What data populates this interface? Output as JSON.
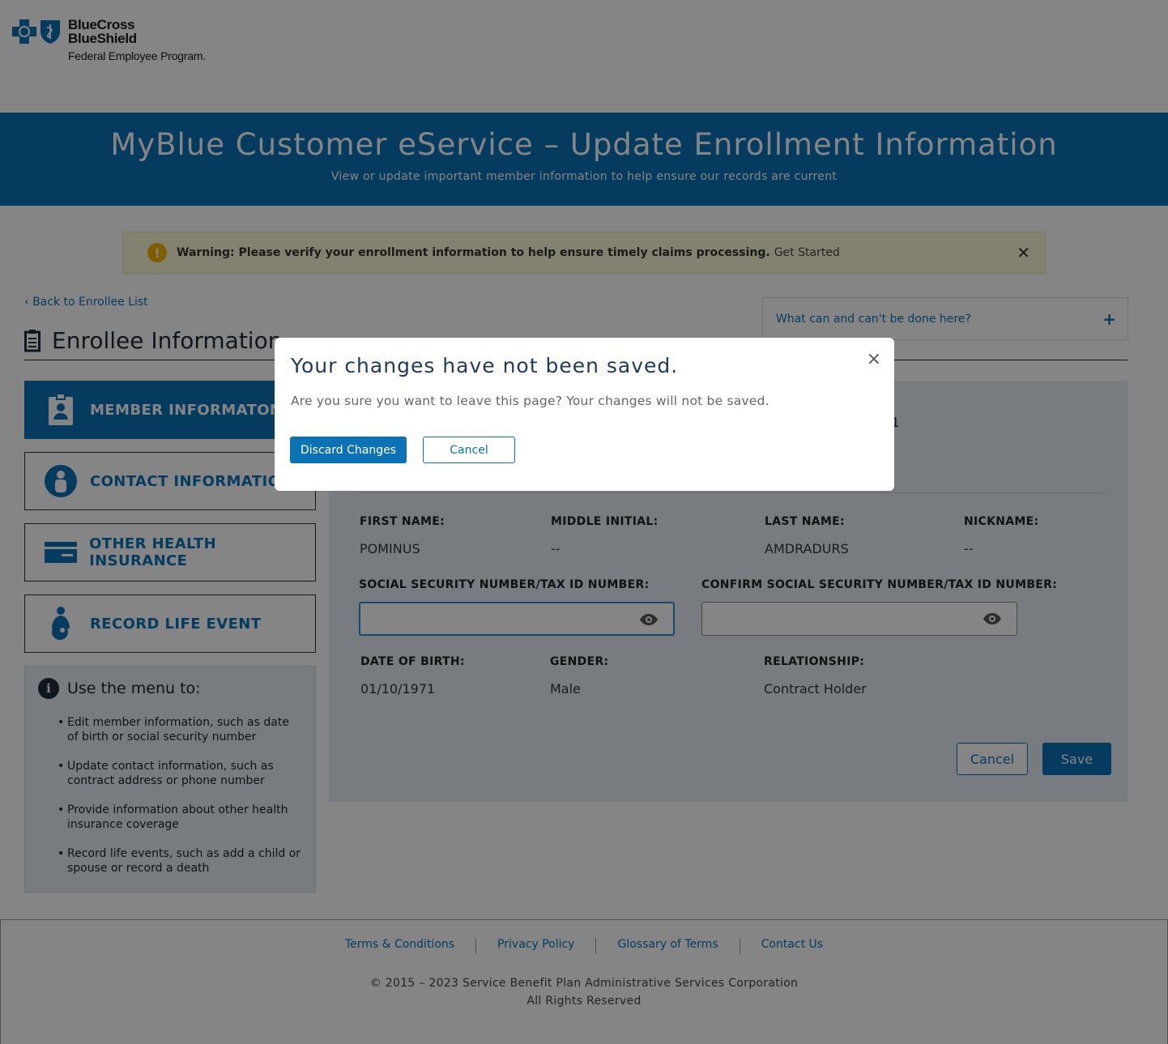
{
  "brand": {
    "line1": "BlueCross",
    "line2": "BlueShield",
    "line3": "Federal Employee Program."
  },
  "hero": {
    "title": "MyBlue Customer eService – Update Enrollment Information",
    "subtitle": "View or update important member information to help ensure our records are current"
  },
  "warning": {
    "text": "Warning: Please verify your enrollment information to help ensure timely claims processing.",
    "link": "Get Started"
  },
  "back_link": "Back to Enrollee List",
  "page_title": "Enrollee Information",
  "help_toggle": "What can and can't be done here?",
  "nav": [
    {
      "label": "MEMBER INFORMATON"
    },
    {
      "label": "CONTACT INFORMATION"
    },
    {
      "label": "OTHER HEALTH INSURANCE"
    },
    {
      "label": "RECORD LIFE EVENT"
    }
  ],
  "info": {
    "heading": "Use the menu to:",
    "items": [
      "Edit member information, such as date of birth or social security number",
      "Update contact information, such as contract address or phone number",
      "Provide information about other health insurance coverage",
      "Record life events, such as add a child or spouse or record a death"
    ]
  },
  "member": {
    "partial_value": "'1",
    "first_name_label": "FIRST NAME:",
    "first_name": "POMINUS",
    "middle_initial_label": "MIDDLE INITIAL:",
    "middle_initial": "--",
    "last_name_label": "LAST NAME:",
    "last_name": "AMDRADURS",
    "nickname_label": "NICKNAME:",
    "nickname": "--",
    "ssn_label": "SOCIAL SECURITY NUMBER/TAX ID NUMBER:",
    "ssn_value": "",
    "confirm_ssn_label": "CONFIRM SOCIAL SECURITY NUMBER/TAX ID NUMBER:",
    "confirm_ssn_value": "",
    "dob_label": "DATE OF BIRTH:",
    "dob": "01/10/1971",
    "gender_label": "GENDER:",
    "gender": "Male",
    "relationship_label": "RELATIONSHIP:",
    "relationship": "Contract Holder",
    "cancel": "Cancel",
    "save": "Save"
  },
  "footer": {
    "links": [
      "Terms & Conditions",
      "Privacy Policy",
      "Glossary of Terms",
      "Contact Us"
    ],
    "copyright": "© 2015 – 2023 Service Benefit Plan Administrative Services Corporation",
    "rights": "All Rights Reserved"
  },
  "modal": {
    "title": "Your changes have not been saved.",
    "text": "Are you sure you want to leave this page? Your changes will not be saved.",
    "discard": "Discard Changes",
    "cancel": "Cancel",
    "close": "×"
  },
  "colors": {
    "primary": "#0b72b5",
    "warning_bg": "#fcf8d6",
    "panel_bg": "#e6eef5"
  }
}
